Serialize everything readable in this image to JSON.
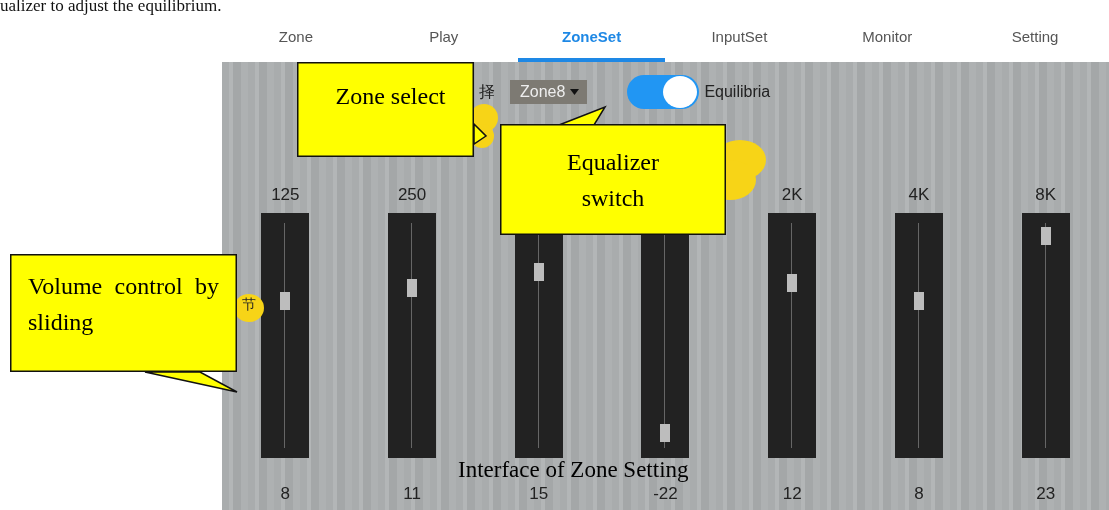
{
  "document_text": "ualizer to adjust the equilibrium.",
  "tabs": [
    {
      "label": "Zone",
      "selected": false
    },
    {
      "label": "Play",
      "selected": false
    },
    {
      "label": "ZoneSet",
      "selected": true
    },
    {
      "label": "InputSet",
      "selected": false
    },
    {
      "label": "Monitor",
      "selected": false
    },
    {
      "label": "Setting",
      "selected": false
    }
  ],
  "zone_label": "择",
  "zone_dropdown": {
    "value": "Zone8"
  },
  "equalizer": {
    "on": true,
    "label": "Equilibria"
  },
  "side_label": "节",
  "bands": [
    {
      "label": "125",
      "value": "8",
      "level": 0.65
    },
    {
      "label": "250",
      "value": "11",
      "level": 0.71
    },
    {
      "value": "15",
      "level": 0.78
    },
    {
      "value": "-22",
      "level": 0.07
    },
    {
      "label": "2K",
      "value": "12",
      "level": 0.73
    },
    {
      "label": "4K",
      "value": "8",
      "level": 0.65
    },
    {
      "label": "8K",
      "value": "23",
      "level": 0.94
    }
  ],
  "callouts": [
    {
      "text": "Zone select"
    },
    {
      "text": "Equalizer switch"
    },
    {
      "text": "Volume control by sliding"
    }
  ],
  "caption": "Interface of Zone Setting"
}
